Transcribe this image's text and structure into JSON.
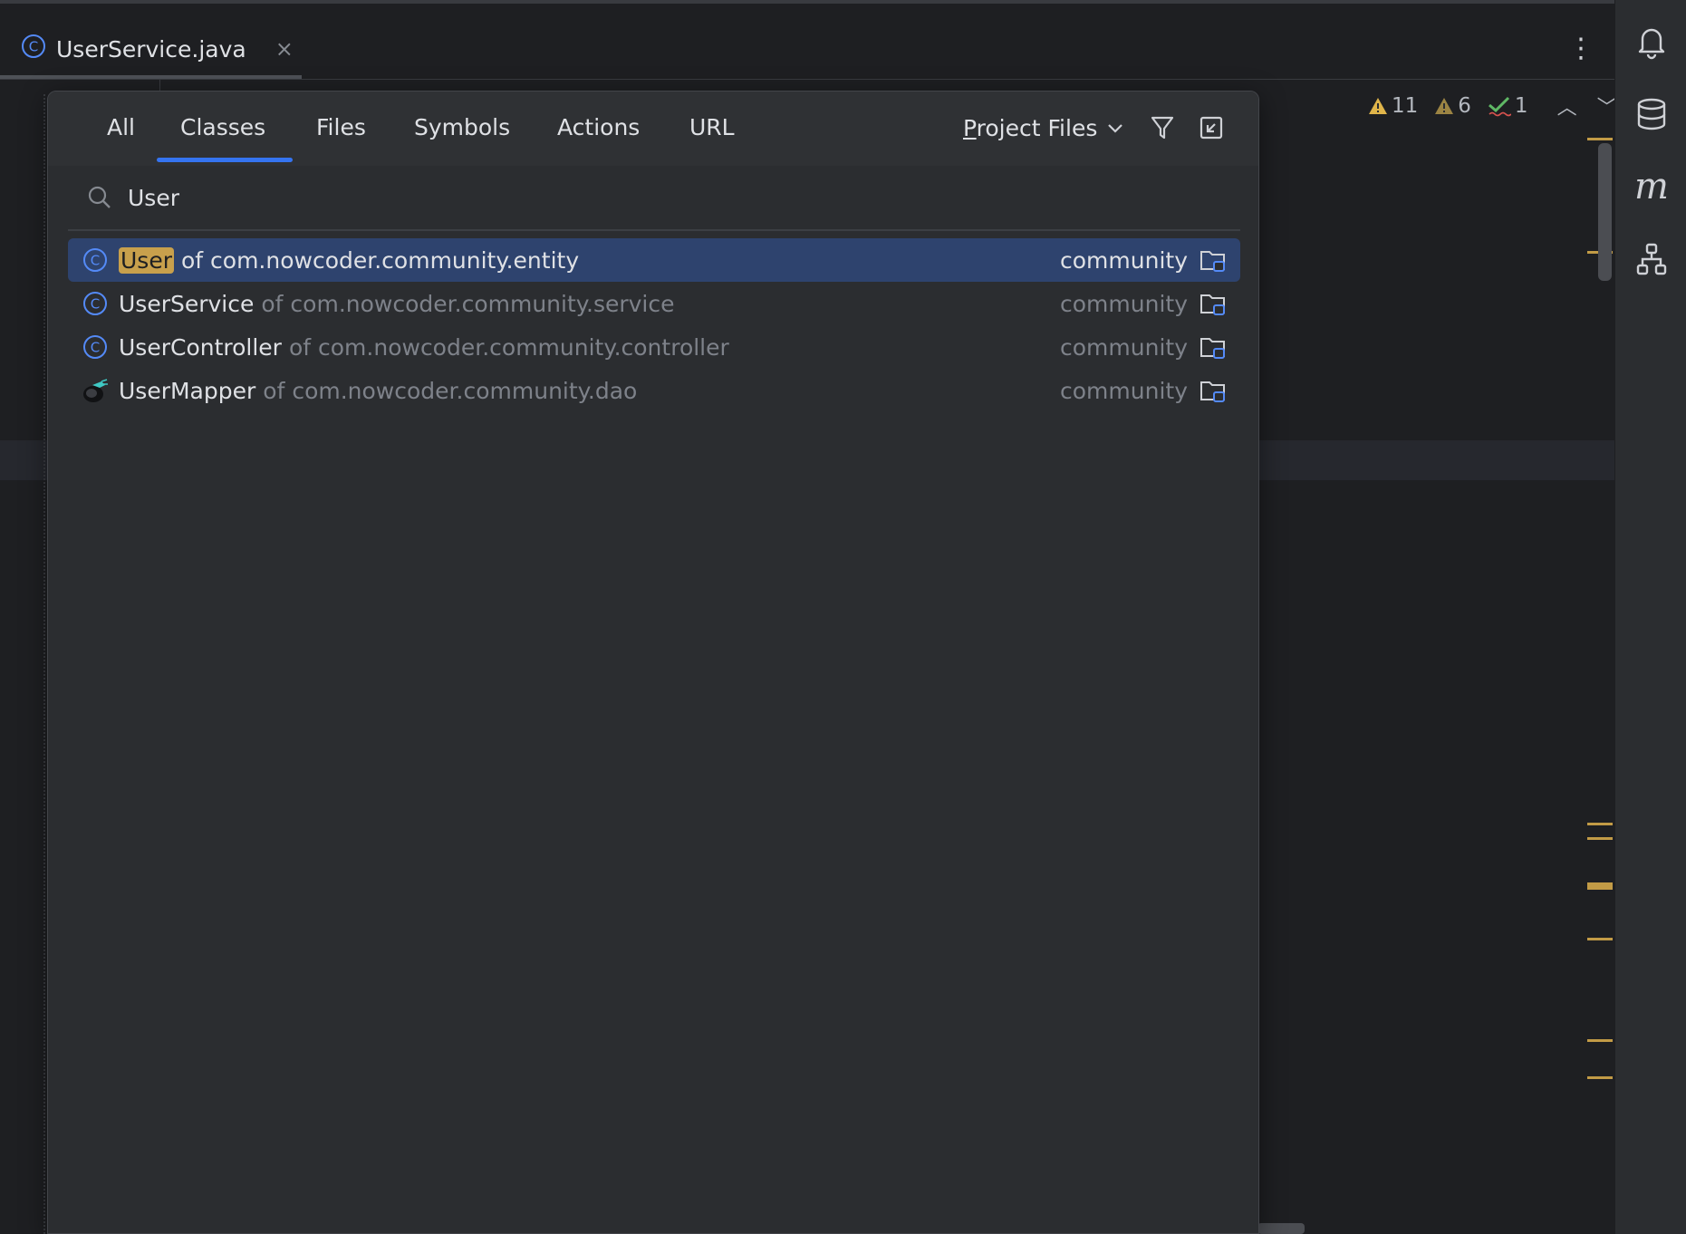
{
  "editor_tab": {
    "file_name": "UserService.java",
    "close_glyph": "×"
  },
  "toolbar": {
    "more_glyph": "⋮"
  },
  "inspections": {
    "warnings": "11",
    "weak_warnings": "6",
    "typos": "1",
    "prev_glyph": "︿",
    "next_glyph": "﹀"
  },
  "right_tools": [
    "bell-icon",
    "database-icon",
    "maven-icon",
    "structure-icon"
  ],
  "popup": {
    "tabs": [
      {
        "label": "All"
      },
      {
        "label": "Classes"
      },
      {
        "label": "Files"
      },
      {
        "label": "Symbols"
      },
      {
        "label": "Actions"
      },
      {
        "label": "URL"
      }
    ],
    "active_tab": "Classes",
    "scope": {
      "first_letter": "P",
      "rest": "roject Files"
    },
    "search": {
      "query": "User",
      "placeholder": ""
    },
    "results": [
      {
        "match": "User",
        "rest": "",
        "package": "of com.nowcoder.community.entity",
        "module": "community",
        "icon": "class-icon",
        "selected": true
      },
      {
        "match": "",
        "rest": "UserService",
        "package": "of com.nowcoder.community.service",
        "module": "community",
        "icon": "class-icon",
        "selected": false
      },
      {
        "match": "",
        "rest": "UserController",
        "package": "of com.nowcoder.community.controller",
        "module": "community",
        "icon": "class-icon",
        "selected": false
      },
      {
        "match": "",
        "rest": "UserMapper",
        "package": "of com.nowcoder.community.dao",
        "module": "community",
        "icon": "mybatis-icon",
        "selected": false
      }
    ]
  },
  "colors": {
    "accent": "#3574f0",
    "selection": "#2e436e",
    "highlight": "#c8a04c",
    "warning": "#e0b54a",
    "ok": "#5fb865"
  }
}
